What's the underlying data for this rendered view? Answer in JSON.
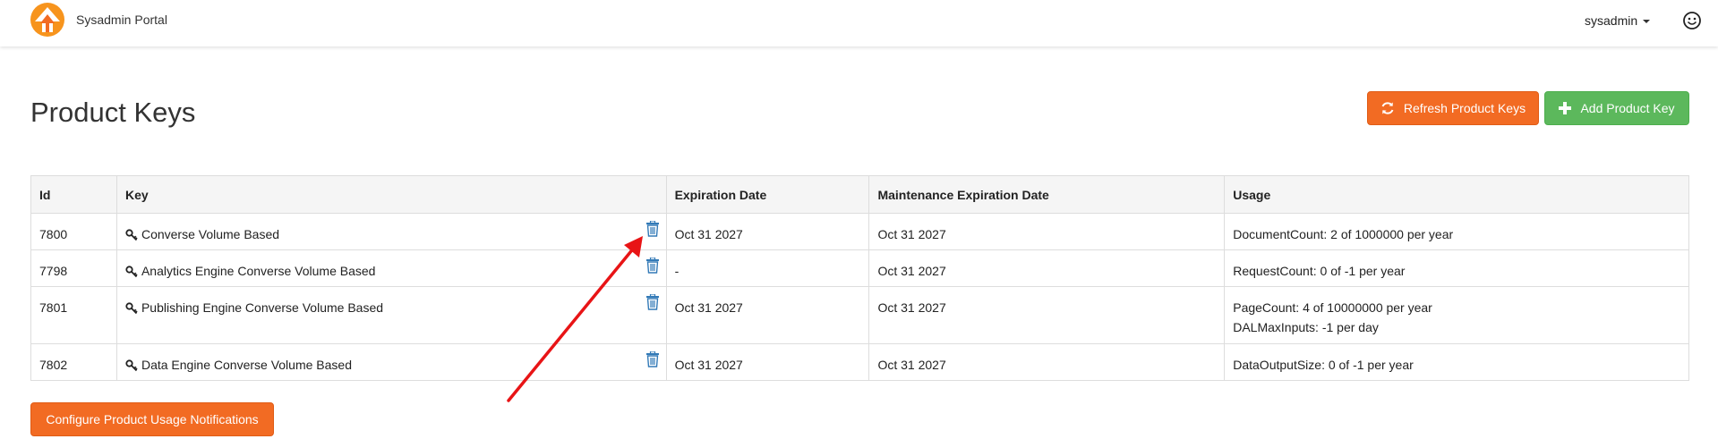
{
  "navbar": {
    "app_title": "Sysadmin Portal",
    "user_name": "sysadmin",
    "user_icon": "smiley-face-icon",
    "brand_color": "#f26b23"
  },
  "page": {
    "title": "Product Keys",
    "refresh_label": "Refresh Product Keys",
    "add_label": "Add Product Key",
    "config_label": "Configure Product Usage Notifications"
  },
  "table": {
    "headers": {
      "id": "Id",
      "key": "Key",
      "expiration": "Expiration Date",
      "maintenance": "Maintenance Expiration Date",
      "usage": "Usage"
    },
    "rows": [
      {
        "id": "7800",
        "key": "Converse Volume Based",
        "expiration": "Oct 31 2027",
        "maintenance": "Oct 31 2027",
        "usage": [
          "DocumentCount: 2 of 1000000 per year"
        ]
      },
      {
        "id": "7798",
        "key": "Analytics Engine Converse Volume Based",
        "expiration": "-",
        "maintenance": "Oct 31 2027",
        "usage": [
          "RequestCount: 0 of -1 per year"
        ]
      },
      {
        "id": "7801",
        "key": "Publishing Engine Converse Volume Based",
        "expiration": "Oct 31 2027",
        "maintenance": "Oct 31 2027",
        "usage": [
          "PageCount: 4 of 10000000 per year",
          "DALMaxInputs: -1 per day"
        ]
      },
      {
        "id": "7802",
        "key": "Data Engine Converse Volume Based",
        "expiration": "Oct 31 2027",
        "maintenance": "Oct 31 2027",
        "usage": [
          "DataOutputSize: 0 of -1 per year"
        ]
      }
    ]
  },
  "colors": {
    "orange": "#f26b23",
    "green": "#5cb85c",
    "trash_blue": "#337ab7",
    "annotation_red": "#e81416"
  }
}
